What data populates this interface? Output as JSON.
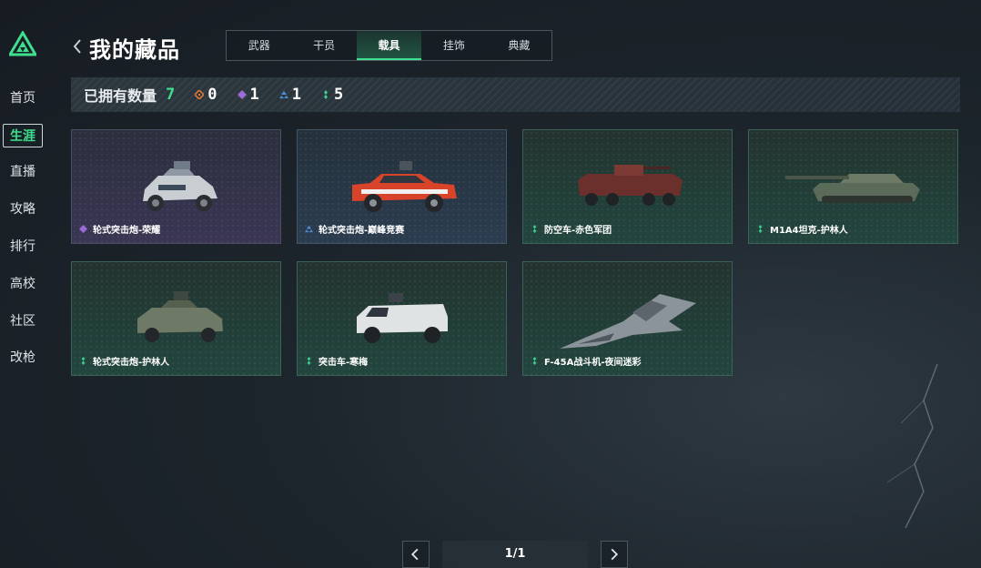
{
  "sidebar": {
    "items": [
      {
        "label": "首页",
        "active": false
      },
      {
        "label": "生涯",
        "active": true
      },
      {
        "label": "直播",
        "active": false
      },
      {
        "label": "攻略",
        "active": false
      },
      {
        "label": "排行",
        "active": false
      },
      {
        "label": "高校",
        "active": false
      },
      {
        "label": "社区",
        "active": false
      },
      {
        "label": "改枪",
        "active": false
      }
    ]
  },
  "header": {
    "title": "我的藏品",
    "tabs": [
      {
        "label": "武器",
        "active": false
      },
      {
        "label": "干员",
        "active": false
      },
      {
        "label": "载具",
        "active": true
      },
      {
        "label": "挂饰",
        "active": false
      },
      {
        "label": "典藏",
        "active": false
      }
    ]
  },
  "stats": {
    "label": "已拥有数量",
    "total": "7",
    "rarities": [
      {
        "icon": "orange-diamond-icon",
        "color": "#d9763a",
        "count": "0"
      },
      {
        "icon": "purple-diamond-icon",
        "color": "#9b6bd6",
        "count": "1"
      },
      {
        "icon": "blue-triangle-icon",
        "color": "#4a8fd8",
        "count": "1"
      },
      {
        "icon": "green-dots-icon",
        "color": "#3ecf8e",
        "count": "5"
      }
    ]
  },
  "items": [
    {
      "name": "轮式突击炮-荣耀",
      "rarity": "purple"
    },
    {
      "name": "轮式突击炮-巅峰竞赛",
      "rarity": "blue"
    },
    {
      "name": "防空车-赤色军团",
      "rarity": "green"
    },
    {
      "name": "M1A4坦克-护林人",
      "rarity": "green"
    },
    {
      "name": "轮式突击炮-护林人",
      "rarity": "green"
    },
    {
      "name": "突击车-寒梅",
      "rarity": "green"
    },
    {
      "name": "F-45A战斗机-夜间迷彩",
      "rarity": "green"
    }
  ],
  "pagination": {
    "text": "1/1"
  },
  "colors": {
    "accent": "#3ee08f"
  }
}
